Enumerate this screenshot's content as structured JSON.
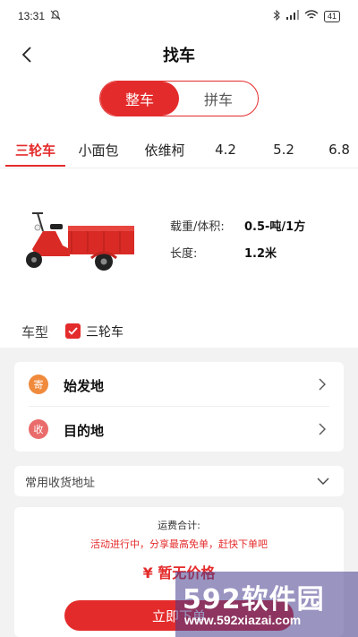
{
  "status_bar": {
    "time": "13:31",
    "battery": "41"
  },
  "header": {
    "title": "找车"
  },
  "segment": {
    "options": [
      "整车",
      "拼车"
    ],
    "active": "整车"
  },
  "tabs": [
    "三轮车",
    "小面包",
    "依维柯",
    "4.2",
    "5.2",
    "6.8"
  ],
  "vehicle": {
    "specs": [
      {
        "label": "载重/体积:",
        "value": "0.5-吨/1方"
      },
      {
        "label": "长度:",
        "value": "1.2米"
      }
    ],
    "type_label": "车型",
    "type_option": "三轮车",
    "type_checked": true
  },
  "address": {
    "origin": {
      "badge": "寄",
      "label": "始发地",
      "color": "#f08a3c"
    },
    "destination": {
      "badge": "收",
      "label": "目的地",
      "color": "#ea6b6b"
    },
    "common": "常用收货地址"
  },
  "fee": {
    "label": "运费合计:",
    "promo": "活动进行中，分享最高免单，赶快下单吧",
    "price": "¥ 暂无价格",
    "button": "立即下单"
  },
  "watermark": {
    "brand": "592软件园",
    "url": "www.592xiazai.com"
  },
  "colors": {
    "accent": "#e42b2b"
  }
}
